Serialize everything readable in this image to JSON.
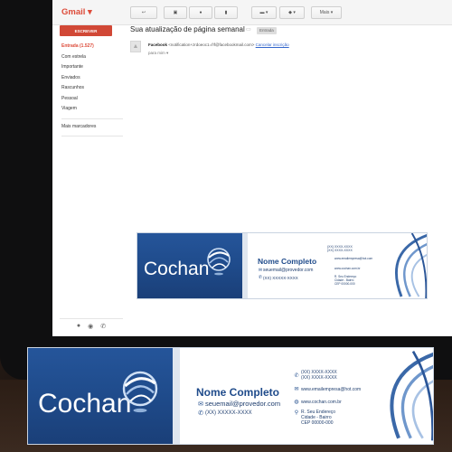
{
  "gmail": {
    "logo": "Gmail ▾",
    "toolbar": {
      "reply_icon": "reply-icon",
      "archive_icon": "archive-icon",
      "spam_icon": "spam-icon",
      "delete_icon": "trash-icon",
      "folder_icon": "folder-icon",
      "label_icon": "label-icon",
      "more_label": "Mais ▾"
    },
    "compose_label": "ESCREVER",
    "sidebar": [
      {
        "label": "Entrada (1.527)",
        "active": true
      },
      {
        "label": "Com estrela",
        "active": false
      },
      {
        "label": "Importante",
        "active": false
      },
      {
        "label": "Enviados",
        "active": false
      },
      {
        "label": "Rascunhos",
        "active": false
      },
      {
        "label": "Pessoal",
        "active": false
      },
      {
        "label": "Viagem",
        "active": false
      }
    ],
    "more_labels": "Mais marcadores",
    "message": {
      "subject": "Sua atualização de página semanal",
      "label": "Entrada",
      "sender_name": "Facebook",
      "sender_email": "<notification+zrdoeoc1=f!f@facebookmail.com>",
      "unsubscribe": "Cancelar inscrição",
      "to": "para mim ▾"
    }
  },
  "signature": {
    "brand": "Cochan",
    "name": "Nome Completo",
    "email": "seuemail@provedor.com",
    "phone": "(XX) XXXXX-XXXX",
    "right": {
      "phone1": "(XX) XXXX-XXXX",
      "phone2": "(XX) XXXX-XXXX",
      "email": "www.emailempresa@hot.com",
      "web": "www.cochan.com.br",
      "address1": "R. Seu Endereço",
      "address2": "Cidade - Bairro",
      "address3": "CEP 00000-000"
    },
    "small_right": {
      "phone1": "(XX) XXXX-XXXX",
      "phone2": "(XX) XXXX-XXXX",
      "email": "www.emailempresa@hot.com",
      "web": "www.cochan.com.br",
      "address1": "R. Seu Endereço",
      "address2": "Cidade - Bairro",
      "address3": "CEP 00000-000"
    }
  },
  "colors": {
    "gmail_red": "#dd4b39",
    "compose_red": "#d14836",
    "brand_blue": "#1f4b8b"
  }
}
